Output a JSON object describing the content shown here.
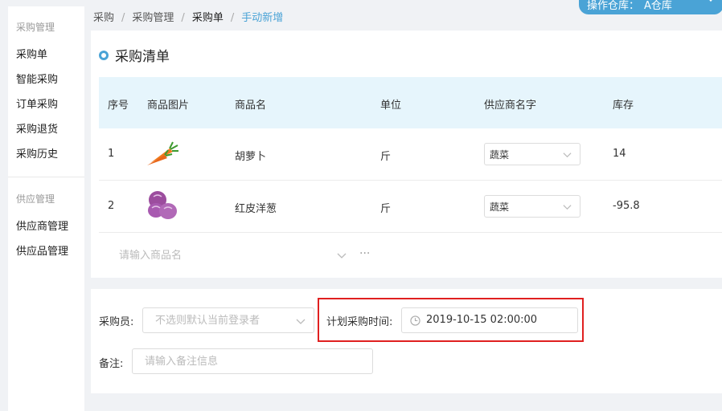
{
  "warehouse": {
    "label": "操作仓库：",
    "value": "A仓库"
  },
  "breadcrumb": [
    "采购",
    "采购管理",
    "采购单",
    "手动新增"
  ],
  "sidebar": {
    "groups": [
      {
        "title": "采购管理",
        "items": [
          "采购单",
          "智能采购",
          "订单采购",
          "采购退货",
          "采购历史"
        ]
      },
      {
        "title": "供应管理",
        "items": [
          "供应商管理",
          "供应品管理"
        ]
      }
    ]
  },
  "section_title": "采购清单",
  "table": {
    "headers": [
      "序号",
      "商品图片",
      "商品名",
      "单位",
      "供应商名字",
      "库存"
    ],
    "rows": [
      {
        "index": "1",
        "image": "carrot-icon",
        "name": "胡萝卜",
        "unit": "斤",
        "supplier": "蔬菜",
        "stock": "14"
      },
      {
        "index": "2",
        "image": "onion-icon",
        "name": "红皮洋葱",
        "unit": "斤",
        "supplier": "蔬菜",
        "stock": "-95.8"
      }
    ],
    "add_row": {
      "placeholder": "请输入商品名",
      "more": "···"
    }
  },
  "form": {
    "buyer_label": "采购员:",
    "buyer_placeholder": "不选则默认当前登录者",
    "plan_time_label": "计划采购时间:",
    "plan_time_value": "2019-10-15 02:00:00",
    "remark_label": "备注:",
    "remark_placeholder": "请输入备注信息"
  },
  "colors": {
    "accent": "#4aa3d6",
    "table_header_bg": "#e6f5fc",
    "highlight": "#e02020"
  }
}
